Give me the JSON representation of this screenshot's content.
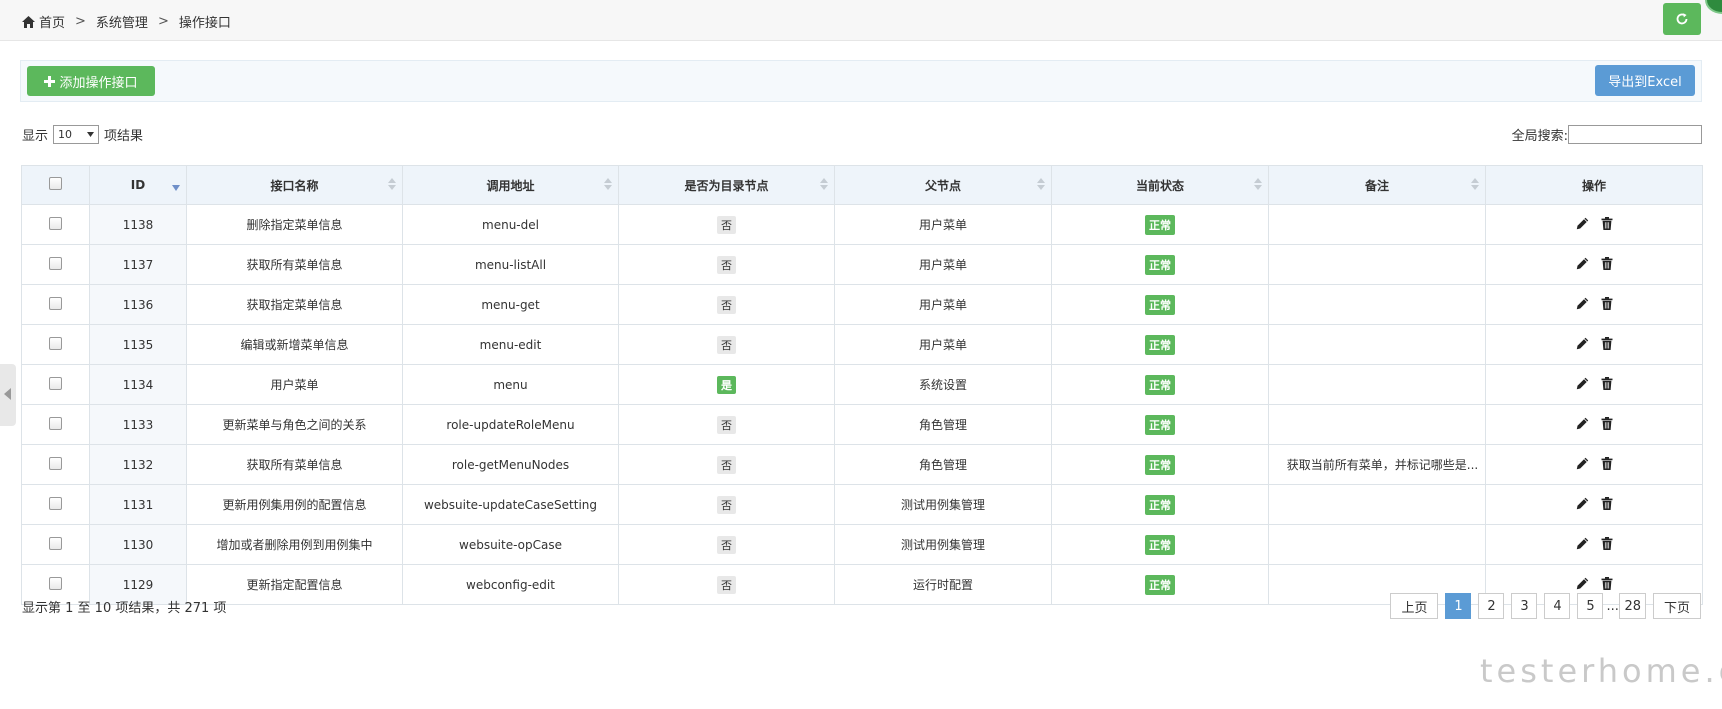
{
  "breadcrumb": {
    "home": "首页",
    "section": "系统管理",
    "current": "操作接口",
    "separator": ">"
  },
  "icons": {
    "home": "home-icon",
    "refresh": "refresh-icon",
    "add": "plus-icon",
    "edit": "pencil-icon",
    "delete": "trash-icon",
    "sort": "sort-icon",
    "sort_desc": "sort-desc-icon"
  },
  "toolbar": {
    "add_label": "添加操作接口",
    "export_label": "导出到Excel"
  },
  "length": {
    "prefix": "显示",
    "value": "10",
    "suffix": "项结果"
  },
  "search": {
    "label": "全局搜索:",
    "value": ""
  },
  "table": {
    "headers": {
      "id": "ID",
      "name": "接口名称",
      "address": "调用地址",
      "is_dir": "是否为目录节点",
      "parent": "父节点",
      "status": "当前状态",
      "remark": "备注",
      "ops": "操作"
    },
    "rows": [
      {
        "id": "1138",
        "name": "删除指定菜单信息",
        "address": "menu-del",
        "is_dir": "否",
        "parent": "用户菜单",
        "status": "正常",
        "remark": ""
      },
      {
        "id": "1137",
        "name": "获取所有菜单信息",
        "address": "menu-listAll",
        "is_dir": "否",
        "parent": "用户菜单",
        "status": "正常",
        "remark": ""
      },
      {
        "id": "1136",
        "name": "获取指定菜单信息",
        "address": "menu-get",
        "is_dir": "否",
        "parent": "用户菜单",
        "status": "正常",
        "remark": ""
      },
      {
        "id": "1135",
        "name": "编辑或新增菜单信息",
        "address": "menu-edit",
        "is_dir": "否",
        "parent": "用户菜单",
        "status": "正常",
        "remark": ""
      },
      {
        "id": "1134",
        "name": "用户菜单",
        "address": "menu",
        "is_dir": "是",
        "parent": "系统设置",
        "status": "正常",
        "remark": ""
      },
      {
        "id": "1133",
        "name": "更新菜单与角色之间的关系",
        "address": "role-updateRoleMenu",
        "is_dir": "否",
        "parent": "角色管理",
        "status": "正常",
        "remark": ""
      },
      {
        "id": "1132",
        "name": "获取所有菜单信息",
        "address": "role-getMenuNodes",
        "is_dir": "否",
        "parent": "角色管理",
        "status": "正常",
        "remark": "获取当前所有菜单，并标记哪些是..."
      },
      {
        "id": "1131",
        "name": "更新用例集用例的配置信息",
        "address": "websuite-updateCaseSetting",
        "is_dir": "否",
        "parent": "测试用例集管理",
        "status": "正常",
        "remark": ""
      },
      {
        "id": "1130",
        "name": "增加或者删除用例到用例集中",
        "address": "websuite-opCase",
        "is_dir": "否",
        "parent": "测试用例集管理",
        "status": "正常",
        "remark": ""
      },
      {
        "id": "1129",
        "name": "更新指定配置信息",
        "address": "webconfig-edit",
        "is_dir": "否",
        "parent": "运行时配置",
        "status": "正常",
        "remark": ""
      }
    ]
  },
  "footer": {
    "info": "显示第 1 至 10 项结果，共 271 项"
  },
  "pagination": {
    "prev": "上页",
    "pages": [
      "1",
      "2",
      "3",
      "4",
      "5"
    ],
    "ellipsis": "...",
    "last": "28",
    "next": "下页",
    "active": "1"
  },
  "watermark": "testerhome.com",
  "colors": {
    "green": "#5cb85c",
    "blue": "#5b9bd5",
    "header_bg": "#eef4fa"
  }
}
